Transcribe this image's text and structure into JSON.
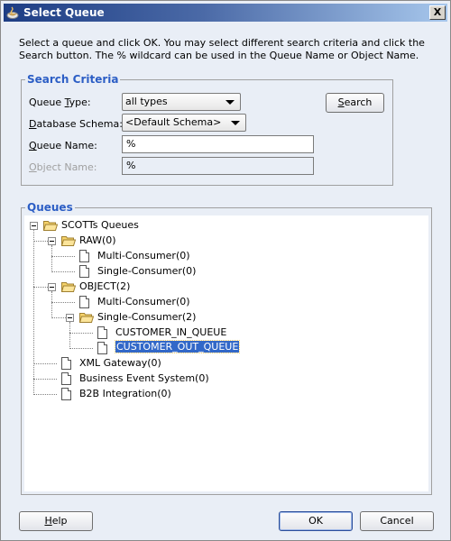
{
  "window": {
    "title": "Select Queue",
    "close_label": "X"
  },
  "instructions": "Select a queue and click OK. You may select different search criteria and click the Search button. The % wildcard can be used in the Queue Name or Object Name.",
  "search_criteria": {
    "legend": "Search Criteria",
    "queue_type_label_pre": "Queue ",
    "queue_type_label_mn": "T",
    "queue_type_label_post": "ype:",
    "queue_type_value": "all types",
    "schema_label_mn": "D",
    "schema_label_post": "atabase Schema:",
    "schema_value": "<Default Schema>",
    "queue_name_label_mn": "Q",
    "queue_name_label_post": "ueue Name:",
    "queue_name_value": "%",
    "object_name_label_mn": "O",
    "object_name_label_post": "bject Name:",
    "object_name_value": "%",
    "search_button_mn": "S",
    "search_button_post": "earch"
  },
  "queues": {
    "legend": "Queues",
    "tree": [
      {
        "label": "SCOTTs Queues",
        "type": "folder",
        "level": 0,
        "expanded": true
      },
      {
        "label": "RAW(0)",
        "type": "folder",
        "level": 1,
        "expanded": true
      },
      {
        "label": "Multi-Consumer(0)",
        "type": "leaf",
        "level": 2
      },
      {
        "label": "Single-Consumer(0)",
        "type": "leaf",
        "level": 2
      },
      {
        "label": "OBJECT(2)",
        "type": "folder",
        "level": 1,
        "expanded": true
      },
      {
        "label": "Multi-Consumer(0)",
        "type": "leaf",
        "level": 2
      },
      {
        "label": "Single-Consumer(2)",
        "type": "folder",
        "level": 2,
        "expanded": true
      },
      {
        "label": "CUSTOMER_IN_QUEUE",
        "type": "leaf",
        "level": 3
      },
      {
        "label": "CUSTOMER_OUT_QUEUE",
        "type": "leaf",
        "level": 3,
        "selected": true
      },
      {
        "label": "XML Gateway(0)",
        "type": "leaf",
        "level": 1
      },
      {
        "label": "Business Event System(0)",
        "type": "leaf",
        "level": 1
      },
      {
        "label": "B2B Integration(0)",
        "type": "leaf",
        "level": 1
      }
    ]
  },
  "footer": {
    "help_mn": "H",
    "help_post": "elp",
    "ok_label": "OK",
    "cancel_label": "Cancel"
  }
}
